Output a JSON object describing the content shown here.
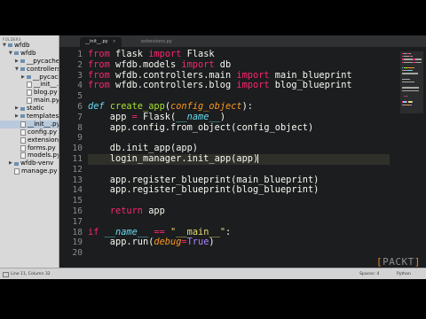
{
  "sidebar": {
    "header": "FOLDERS",
    "items": [
      {
        "label": "wfdb",
        "twisty": "▼",
        "icon": "folder-icon",
        "depth": 0
      },
      {
        "label": "wfdb",
        "twisty": "▼",
        "icon": "folder-icon",
        "depth": 1
      },
      {
        "label": "__pycache__",
        "twisty": "▶",
        "icon": "folder-icon",
        "depth": 2
      },
      {
        "label": "controllers",
        "twisty": "▼",
        "icon": "folder-icon",
        "depth": 2
      },
      {
        "label": "__pycache__",
        "twisty": "▶",
        "icon": "folder-icon",
        "depth": 3
      },
      {
        "label": "__init__.py",
        "twisty": "",
        "icon": "file-icon",
        "depth": 3
      },
      {
        "label": "blog.py",
        "twisty": "",
        "icon": "file-icon",
        "depth": 3
      },
      {
        "label": "main.py",
        "twisty": "",
        "icon": "file-icon",
        "depth": 3
      },
      {
        "label": "static",
        "twisty": "▶",
        "icon": "folder-icon",
        "depth": 2
      },
      {
        "label": "templates",
        "twisty": "▶",
        "icon": "folder-icon",
        "depth": 2
      },
      {
        "label": "__init__.py",
        "twisty": "",
        "icon": "file-icon",
        "depth": 2,
        "selected": true
      },
      {
        "label": "config.py",
        "twisty": "",
        "icon": "file-icon",
        "depth": 2
      },
      {
        "label": "extensions.py",
        "twisty": "",
        "icon": "file-icon",
        "depth": 2
      },
      {
        "label": "forms.py",
        "twisty": "",
        "icon": "file-icon",
        "depth": 2
      },
      {
        "label": "models.py",
        "twisty": "",
        "icon": "file-icon",
        "depth": 2
      },
      {
        "label": "wfdb-venv",
        "twisty": "▶",
        "icon": "folder-icon",
        "depth": 1
      },
      {
        "label": "manage.py",
        "twisty": "",
        "icon": "file-icon",
        "depth": 1
      }
    ]
  },
  "tabs": [
    {
      "label": "__init__.py",
      "active": true
    },
    {
      "label": "extensions.py",
      "active": false
    }
  ],
  "editor": {
    "line_numbers": [
      "1",
      "2",
      "3",
      "4",
      "5",
      "6",
      "7",
      "8",
      "9",
      "10",
      "11",
      "12",
      "13",
      "14",
      "15",
      "16",
      "17",
      "18",
      "19",
      "20"
    ],
    "current_line": 11,
    "lines": [
      [
        [
          "kw",
          "from"
        ],
        [
          "t",
          " flask "
        ],
        [
          "kw",
          "import"
        ],
        [
          "t",
          " Flask"
        ]
      ],
      [
        [
          "kw",
          "from"
        ],
        [
          "t",
          " wfdb.models "
        ],
        [
          "kw",
          "import"
        ],
        [
          "t",
          " db"
        ]
      ],
      [
        [
          "kw",
          "from"
        ],
        [
          "t",
          " wfdb.controllers.main "
        ],
        [
          "kw",
          "import"
        ],
        [
          "t",
          " main_blueprint"
        ]
      ],
      [
        [
          "kw",
          "from"
        ],
        [
          "t",
          " wfdb.controllers.blog "
        ],
        [
          "kw",
          "import"
        ],
        [
          "t",
          " blog_blueprint"
        ]
      ],
      [],
      [
        [
          "bi",
          "def"
        ],
        [
          "t",
          " "
        ],
        [
          "fn",
          "create_app"
        ],
        [
          "t",
          "("
        ],
        [
          "pm",
          "config_object"
        ],
        [
          "t",
          "):"
        ]
      ],
      [
        [
          "t",
          "    app "
        ],
        [
          "kw",
          "="
        ],
        [
          "t",
          " Flask("
        ],
        [
          "bi",
          "__name__"
        ],
        [
          "t",
          ")"
        ]
      ],
      [
        [
          "t",
          "    app.config.from_object(config_object)"
        ]
      ],
      [],
      [
        [
          "t",
          "    db.init_app(app)"
        ]
      ],
      [
        [
          "t",
          "    login_manager.init_app(app)"
        ],
        [
          "cursor",
          ""
        ]
      ],
      [],
      [
        [
          "t",
          "    app.register_blueprint(main_blueprint)"
        ]
      ],
      [
        [
          "t",
          "    app.register_blueprint(blog_blueprint)"
        ]
      ],
      [],
      [
        [
          "t",
          "    "
        ],
        [
          "kw",
          "return"
        ],
        [
          "t",
          " app"
        ]
      ],
      [],
      [
        [
          "kw",
          "if"
        ],
        [
          "t",
          " "
        ],
        [
          "bi",
          "__name__"
        ],
        [
          "t",
          " "
        ],
        [
          "kw",
          "=="
        ],
        [
          "t",
          " "
        ],
        [
          "st",
          "\"__main__\""
        ],
        [
          "t",
          ":"
        ]
      ],
      [
        [
          "t",
          "    app.run("
        ],
        [
          "pm",
          "debug"
        ],
        [
          "kw",
          "="
        ],
        [
          "cn",
          "True"
        ],
        [
          "t",
          ")"
        ]
      ],
      []
    ]
  },
  "status": {
    "position": "Line 11, Column 32",
    "spaces": "Spaces: 4",
    "language": "Python"
  },
  "watermark": {
    "open": "[",
    "text": "PACKT",
    "close": "]"
  },
  "colors": {
    "editor_bg": "#1b1d1e",
    "keyword": "#f92672",
    "function": "#a6e22e",
    "parameter": "#fd971f",
    "builtin": "#66d9ef",
    "string": "#e6db74",
    "constant": "#ae81ff",
    "accent": "#e58a2e"
  }
}
